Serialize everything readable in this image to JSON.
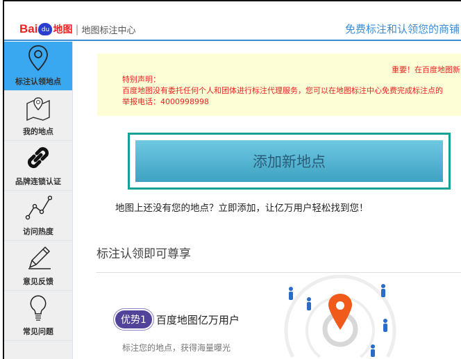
{
  "header": {
    "logo_brand": "Bai du 地图",
    "subtitle": "地图标注中心",
    "slogan": "免费标注和认领您的商铺"
  },
  "sidebar": {
    "items": [
      {
        "label": "标注认领地点",
        "icon": "location-pin-icon",
        "active": true
      },
      {
        "label": "我的地点",
        "icon": "map-icon"
      },
      {
        "label": "品牌连锁认证",
        "icon": "link-icon"
      },
      {
        "label": "访问热度",
        "icon": "line-chart-icon"
      },
      {
        "label": "意见反馈",
        "icon": "pencil-icon"
      },
      {
        "label": "常见问题",
        "icon": "lightbulb-icon"
      }
    ]
  },
  "notice": {
    "important": "重要！在百度地图新",
    "title": "特别声明：",
    "body": "百度地图没有委托任何个人和团体进行标注代理服务，您可以在地图标注中心免费完成标注点的",
    "phone": "举报电话：4000998998"
  },
  "main": {
    "add_button": "添加新地点",
    "hint": "地图上还没有您的地点？立即添加，让亿万用户轻松找到您！",
    "section_title": "标注认领即可尊享",
    "advantage": {
      "badge": "优势1",
      "title": "百度地图亿万用户",
      "desc": "标注您的地点，获得海量曝光"
    }
  },
  "colors": {
    "accent": "#3aa8f0",
    "pin": "#f05a1a",
    "badge": "#51439a"
  }
}
